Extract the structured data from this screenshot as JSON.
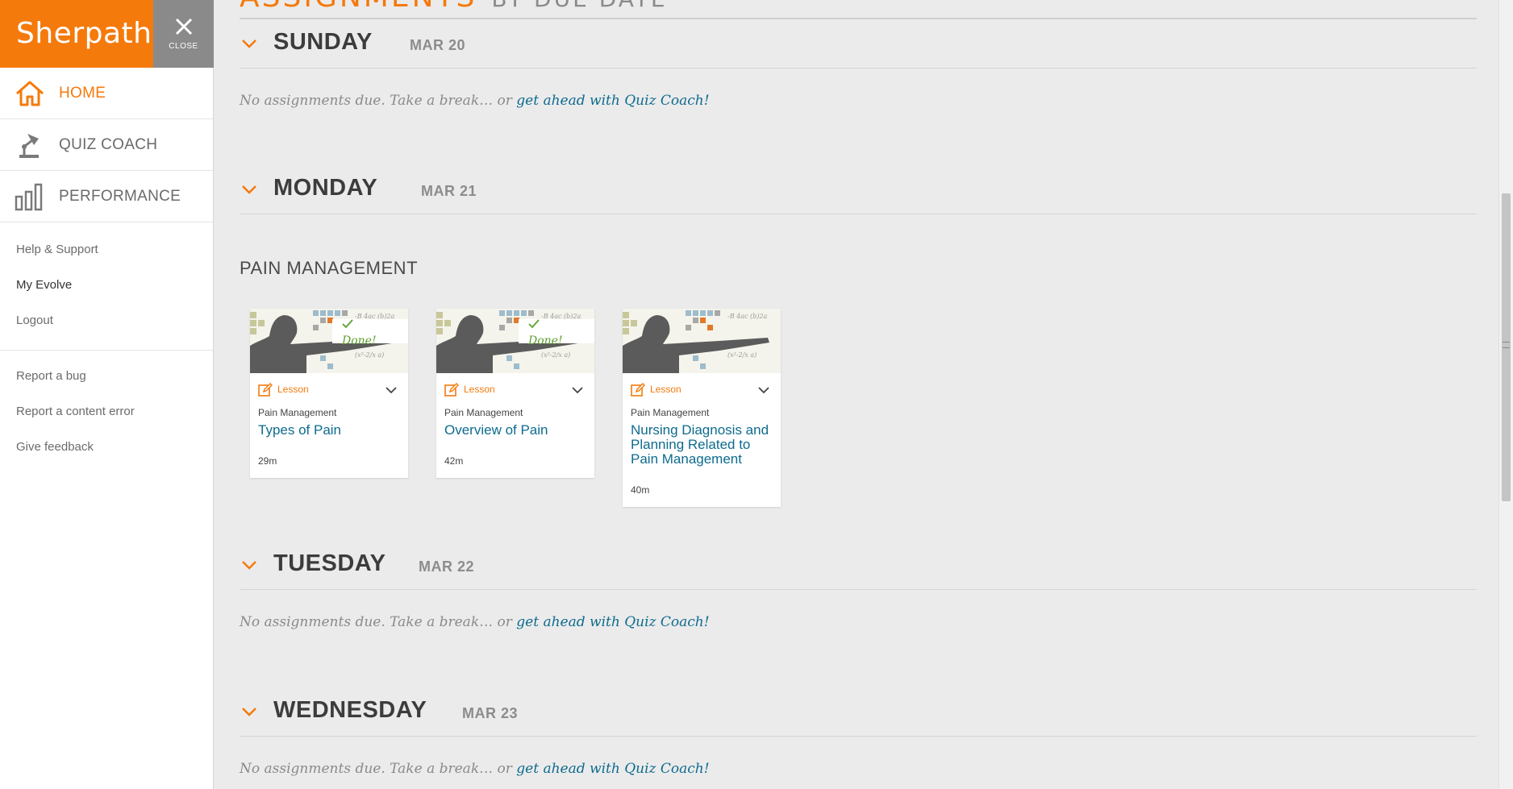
{
  "app": {
    "brand": "Sherpath",
    "close_label": "CLOSE",
    "accent": "#f47a0c",
    "link_color": "#0d6b8e"
  },
  "sidebar": {
    "nav": [
      {
        "label": "HOME",
        "icon": "home-icon",
        "active": true
      },
      {
        "label": "QUIZ COACH",
        "icon": "desk-lamp-icon",
        "active": false
      },
      {
        "label": "PERFORMANCE",
        "icon": "bar-chart-icon",
        "active": false
      }
    ],
    "links_primary": [
      "Help & Support",
      "My Evolve",
      "Logout"
    ],
    "links_secondary": [
      "Report a bug",
      "Report a content error",
      "Give feedback"
    ]
  },
  "main": {
    "heading": "ASSIGNMENTS",
    "heading_sub": "BY DUE DATE",
    "no_assignments_text": "No assignments due. Take a break… or ",
    "quiz_coach_link": "get ahead with Quiz Coach!",
    "days": [
      {
        "day": "SUNDAY",
        "date": "MAR 20"
      },
      {
        "day": "MONDAY",
        "date": "MAR 21"
      },
      {
        "day": "TUESDAY",
        "date": "MAR 22"
      },
      {
        "day": "WEDNESDAY",
        "date": "MAR 23"
      }
    ],
    "monday_section": "PAIN MANAGEMENT",
    "cards": [
      {
        "type": "Lesson",
        "course": "Pain Management",
        "title": "Types of Pain",
        "duration": "29m",
        "status": "Done!"
      },
      {
        "type": "Lesson",
        "course": "Pain Management",
        "title": "Overview of Pain",
        "duration": "42m",
        "status": "Done!"
      },
      {
        "type": "Lesson",
        "course": "Pain Management",
        "title": "Nursing Diagnosis and Planning Related to Pain Management",
        "duration": "40m",
        "status": ""
      }
    ]
  }
}
